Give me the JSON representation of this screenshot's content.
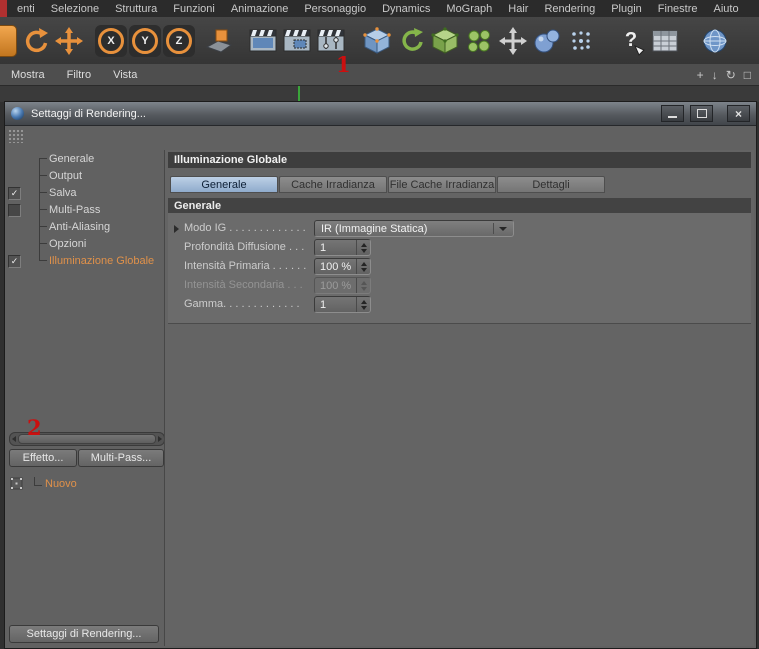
{
  "menubar": {
    "items": [
      "enti",
      "Selezione",
      "Struttura",
      "Funzioni",
      "Animazione",
      "Personaggio",
      "Dynamics",
      "MoGraph",
      "Hair",
      "Rendering",
      "Plugin",
      "Finestre",
      "Aiuto"
    ]
  },
  "toolbar": {
    "icons": [
      "partial-tool-icon",
      "rotate-tool-icon",
      "move-tool-icon",
      "x-axis-lock-icon",
      "y-axis-lock-icon",
      "z-axis-lock-icon",
      "workplane-icon",
      "render-view-icon",
      "render-region-icon",
      "render-settings-icon",
      "add-cube-icon",
      "green-rotate-icon",
      "green-cube-icon",
      "cluster-icon",
      "expand-arrows-icon",
      "metaball-icon",
      "particles-icon",
      "help-icon",
      "spreadsheet-icon",
      "browser-globe-icon"
    ]
  },
  "viewbar": {
    "items": [
      "Mostra",
      "Filtro",
      "Vista"
    ],
    "nav_icons": [
      "pan-icon",
      "dolly-icon",
      "rotate-view-icon",
      "toggle-view-icon"
    ]
  },
  "annotations": {
    "step1": "1",
    "step2": "2"
  },
  "window": {
    "title": "Settaggi di Rendering...",
    "titlebar_buttons": [
      "minimize",
      "maximize",
      "close"
    ],
    "close_glyph": "×",
    "check_glyph": "✓",
    "tree": {
      "items": [
        {
          "label": "Generale"
        },
        {
          "label": "Output"
        },
        {
          "label": "Salva",
          "check": "checked"
        },
        {
          "label": "Multi-Pass",
          "check": "unchecked"
        },
        {
          "label": "Anti-Aliasing"
        },
        {
          "label": "Opzioni"
        },
        {
          "label": "Illuminazione Globale",
          "check": "checked",
          "active": true
        }
      ]
    },
    "panel": {
      "header": "Illuminazione Globale",
      "tabs": [
        {
          "label": "Generale",
          "active": true
        },
        {
          "label": "Cache Irradianza"
        },
        {
          "label": "File Cache Irradianza"
        },
        {
          "label": "Dettagli"
        }
      ],
      "section": "Generale",
      "fields": [
        {
          "label": "Modo IG . . . . . . . . . . . . .",
          "value": "IR (Immagine Statica)",
          "type": "dropdown"
        },
        {
          "label": "Profondità Diffusione . . .",
          "value": "1",
          "type": "spinner"
        },
        {
          "label": "Intensità Primaria . . . . . .",
          "value": "100 %",
          "type": "spinner"
        },
        {
          "label": "Intensità Secondaria . . .",
          "value": "100 %",
          "type": "spinner",
          "disabled": true
        },
        {
          "label": "Gamma. . . . . . . . . . . . .",
          "value": "1",
          "type": "spinner"
        }
      ]
    },
    "effetto_button": "Effetto...",
    "multipass_button": "Multi-Pass...",
    "list_item_nuovo": "Nuovo",
    "bottom_button": "Settaggi di Rendering..."
  }
}
